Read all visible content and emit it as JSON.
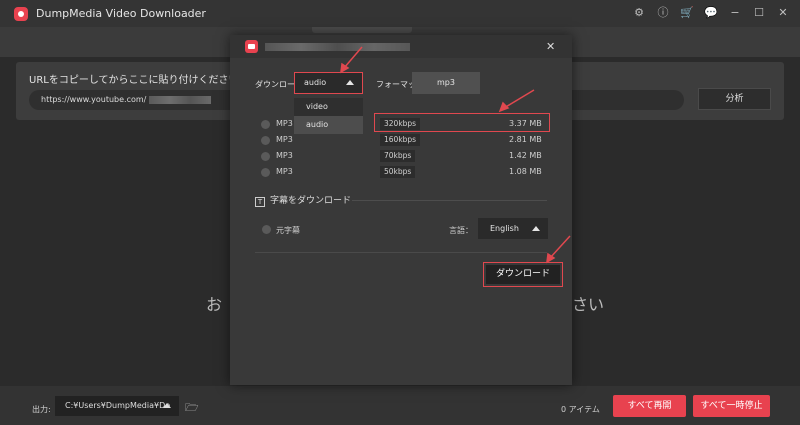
{
  "app": {
    "title": "DumpMedia Video Downloader"
  },
  "window_icons": [
    "gear-icon",
    "info-icon",
    "cart-icon",
    "chat-icon",
    "minimize-icon",
    "maximize-icon",
    "close-icon"
  ],
  "url_panel": {
    "label": "URLをコピーしてからここに貼り付けください：",
    "url_value": "https://www.youtube.com/",
    "analyze_label": "分析"
  },
  "background_text": {
    "left": "お",
    "right": "さい"
  },
  "modal": {
    "download_label": "ダウンロード:",
    "format_selected": "audio",
    "format_options": [
      "video",
      "audio"
    ],
    "format_label": "フォーマット:",
    "format_value": "mp3",
    "qualities": [
      {
        "format": "MP3",
        "bitrate": "320kbps",
        "size": "3.37 MB"
      },
      {
        "format": "MP3",
        "bitrate": "160kbps",
        "size": "2.81 MB"
      },
      {
        "format": "MP3",
        "bitrate": "70kbps",
        "size": "1.42 MB"
      },
      {
        "format": "MP3",
        "bitrate": "50kbps",
        "size": "1.08 MB"
      }
    ],
    "subtitle_section": "字幕をダウンロード",
    "subtitle_option": "元字幕",
    "language_label": "言語：",
    "language_value": "English",
    "download_button": "ダウンロード"
  },
  "bottom": {
    "output_label": "出力:",
    "output_path": "C:¥Users¥DumpMedia¥De",
    "items_count": "0 アイテム",
    "resume_all": "すべて再開",
    "pause_all": "すべて一時停止"
  },
  "colors": {
    "accent": "#e8424f",
    "background": "#2b2b2b",
    "panel": "#3d3d3d"
  }
}
